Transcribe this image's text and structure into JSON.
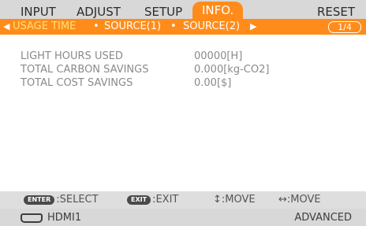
{
  "tabs": [
    {
      "label": "INPUT"
    },
    {
      "label": "ADJUST"
    },
    {
      "label": "SETUP"
    },
    {
      "label": "INFO."
    },
    {
      "label": "RESET"
    }
  ],
  "active_tab": "INFO.",
  "subtabs": [
    {
      "label": "USAGE TIME"
    },
    {
      "label": "SOURCE(1)"
    },
    {
      "label": "SOURCE(2)"
    }
  ],
  "page_indicator": "1/4",
  "rows": [
    {
      "label": "LIGHT HOURS USED",
      "value": "00000[H]"
    },
    {
      "label": "TOTAL CARBON SAVINGS",
      "value": "0.000[kg-CO2]"
    },
    {
      "label": "TOTAL COST SAVINGS",
      "value": "0.00[$]"
    }
  ],
  "help": {
    "enter_key": "ENTER",
    "select_label": ":SELECT",
    "exit_key": "EXIT",
    "exit_label": ":EXIT",
    "move_vertical": "↕:MOVE",
    "move_horizontal": "↔:MOVE"
  },
  "status": {
    "source": "HDMI1",
    "mode": "ADVANCED"
  },
  "colors": {
    "accent": "#ff8c1a",
    "active_subtab": "#ffe37a"
  }
}
